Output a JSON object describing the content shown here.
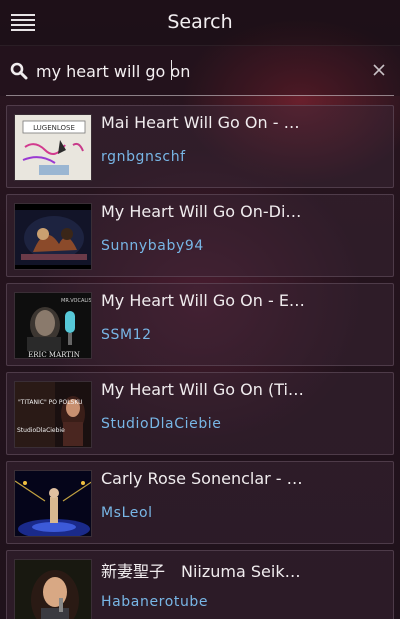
{
  "header": {
    "title": "Search"
  },
  "search": {
    "value": "my heart will go on"
  },
  "results": [
    {
      "title": "Mai Heart Will Go On - …",
      "user": "rgnbgnschf",
      "thumb_text": "LUGENLOSE",
      "thumb_bg": "#e8e4dc"
    },
    {
      "title": "My Heart Will Go On-Di…",
      "user": "Sunnybaby94",
      "thumb_text": "",
      "thumb_bg": "#0c0c18"
    },
    {
      "title": "My Heart Will Go On - E…",
      "user": "SSM12",
      "thumb_text": "ERIC MARTIN",
      "thumb_bg": "#111111"
    },
    {
      "title": "My Heart Will Go On (Ti…",
      "user": "StudioDlaCiebie",
      "thumb_text": "\"TITANIC\" PO POLSKU",
      "thumb_bg": "#1a1010"
    },
    {
      "title": "Carly Rose Sonenclar - …",
      "user": "MsLeol",
      "thumb_text": "",
      "thumb_bg": "#05051a"
    },
    {
      "title": "新妻聖子　Niizuma Seik…",
      "user": "Habanerotube",
      "thumb_text": "",
      "thumb_bg": "#181810"
    }
  ],
  "colors": {
    "accent_link": "#78b6e6",
    "text": "#f0ecee"
  }
}
